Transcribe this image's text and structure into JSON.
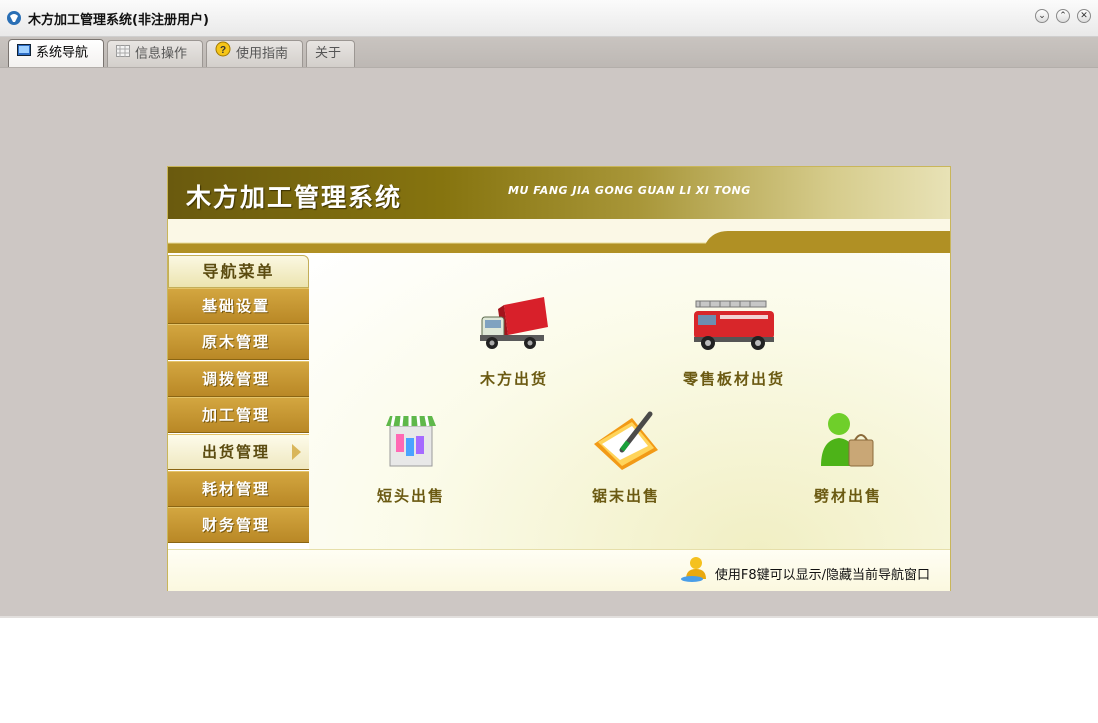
{
  "window": {
    "title": "木方加工管理系统(非注册用户)",
    "controls": [
      "minimize",
      "restore",
      "close"
    ]
  },
  "tabs": [
    {
      "label": "系统导航",
      "icon": "monitor-icon",
      "active": true
    },
    {
      "label": "信息操作",
      "icon": "grid-icon",
      "active": false
    },
    {
      "label": "使用指南",
      "icon": "help-icon",
      "active": false
    },
    {
      "label": "关于",
      "icon": "",
      "active": false
    }
  ],
  "panel": {
    "title": "木方加工管理系统",
    "subtitle": "MU FANG JIA GONG GUAN LI XI TONG",
    "nav_header": "导航菜单",
    "nav_items": [
      {
        "label": "基础设置",
        "selected": false
      },
      {
        "label": "原木管理",
        "selected": false
      },
      {
        "label": "调拨管理",
        "selected": false
      },
      {
        "label": "加工管理",
        "selected": false
      },
      {
        "label": "出货管理",
        "selected": true
      },
      {
        "label": "耗材管理",
        "selected": false
      },
      {
        "label": "财务管理",
        "selected": false
      }
    ],
    "functions": [
      {
        "label": "木方出货",
        "icon": "truck-icon"
      },
      {
        "label": "零售板材出货",
        "icon": "fire-truck-icon"
      },
      {
        "label": "短头出售",
        "icon": "shop-icon"
      },
      {
        "label": "锯末出售",
        "icon": "folder-pen-icon"
      },
      {
        "label": "劈材出售",
        "icon": "user-bag-icon"
      }
    ],
    "hint": "使用F8键可以显示/隐藏当前导航窗口"
  },
  "colors": {
    "accent": "#b98826",
    "banner": "#86740f",
    "workspace": "#cdc7c4"
  }
}
